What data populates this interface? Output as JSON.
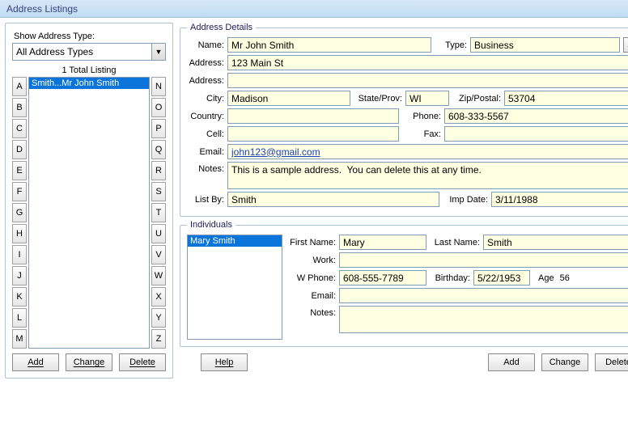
{
  "window": {
    "title": "Address Listings"
  },
  "leftPane": {
    "showTypeLabel": "Show Address Type:",
    "showTypeValue": "All Address Types",
    "totalLabel": "1 Total Listing",
    "listingItem": "Smith...Mr John Smith",
    "alphaLeft": [
      "A",
      "B",
      "C",
      "D",
      "E",
      "F",
      "G",
      "H",
      "I",
      "J",
      "K",
      "L",
      "M"
    ],
    "alphaRight": [
      "N",
      "O",
      "P",
      "Q",
      "R",
      "S",
      "T",
      "U",
      "V",
      "W",
      "X",
      "Y",
      "Z"
    ],
    "buttons": {
      "add": "Add",
      "change": "Change",
      "delete": "Delete"
    }
  },
  "details": {
    "legend": "Address Details",
    "labels": {
      "name": "Name:",
      "type": "Type:",
      "address": "Address:",
      "city": "City:",
      "stateProv": "State/Prov:",
      "zip": "Zip/Postal:",
      "country": "Country:",
      "phone": "Phone:",
      "cell": "Cell:",
      "fax": "Fax:",
      "email": "Email:",
      "notes": "Notes:",
      "listBy": "List By:",
      "impDate": "Imp Date:"
    },
    "values": {
      "name": "Mr John Smith",
      "type": "Business",
      "address1": "123 Main St",
      "address2": "",
      "city": "Madison",
      "stateProv": "WI",
      "zip": "53704",
      "country": "",
      "phone": "608-333-5567",
      "cell": "",
      "fax": "",
      "email": "john123@gmail.com",
      "notes": "This is a sample address.  You can delete this at any time.",
      "listBy": "Smith",
      "impDate": "3/11/1988"
    }
  },
  "individuals": {
    "legend": "Individuals",
    "selected": "Mary Smith",
    "labels": {
      "firstName": "First Name:",
      "lastName": "Last Name:",
      "work": "Work:",
      "wPhone": "W Phone:",
      "birthday": "Birthday:",
      "age": "Age",
      "email": "Email:",
      "notes": "Notes:"
    },
    "values": {
      "firstName": "Mary",
      "lastName": "Smith",
      "work": "",
      "wPhone": "608-555-7789",
      "birthday": "5/22/1953",
      "age": "56",
      "email": "",
      "notes": ""
    }
  },
  "footer": {
    "help": "Help",
    "add": "Add",
    "change": "Change",
    "delete": "Delete"
  }
}
